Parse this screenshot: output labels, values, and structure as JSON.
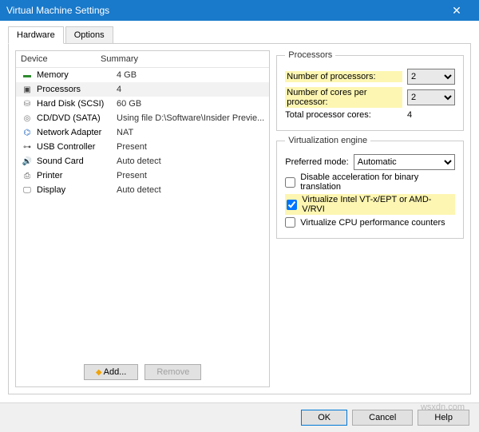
{
  "window": {
    "title": "Virtual Machine Settings"
  },
  "tabs": {
    "hardware": "Hardware",
    "options": "Options"
  },
  "devheader": {
    "device": "Device",
    "summary": "Summary"
  },
  "devices": [
    {
      "name": "Memory",
      "summary": "4 GB",
      "iconColor": "#2e8b2e",
      "glyph": "▬"
    },
    {
      "name": "Processors",
      "summary": "4",
      "iconColor": "#444",
      "glyph": "▣",
      "selected": true
    },
    {
      "name": "Hard Disk (SCSI)",
      "summary": "60 GB",
      "iconColor": "#777",
      "glyph": "⛁"
    },
    {
      "name": "CD/DVD (SATA)",
      "summary": "Using file D:\\Software\\Insider Previe...",
      "iconColor": "#777",
      "glyph": "◎"
    },
    {
      "name": "Network Adapter",
      "summary": "NAT",
      "iconColor": "#2a6cc2",
      "glyph": "⌬"
    },
    {
      "name": "USB Controller",
      "summary": "Present",
      "iconColor": "#555",
      "glyph": "⊶"
    },
    {
      "name": "Sound Card",
      "summary": "Auto detect",
      "iconColor": "#c78b1d",
      "glyph": "🔊"
    },
    {
      "name": "Printer",
      "summary": "Present",
      "iconColor": "#555",
      "glyph": "⎙"
    },
    {
      "name": "Display",
      "summary": "Auto detect",
      "iconColor": "#555",
      "glyph": "🖵"
    }
  ],
  "buttons": {
    "add": "Add...",
    "remove": "Remove",
    "ok": "OK",
    "cancel": "Cancel",
    "help": "Help"
  },
  "proc": {
    "legend": "Processors",
    "numProcLabel": "Number of processors:",
    "numProcValue": "2",
    "coresLabel": "Number of cores per processor:",
    "coresValue": "2",
    "totalLabel": "Total processor cores:",
    "totalValue": "4"
  },
  "virt": {
    "legend": "Virtualization engine",
    "prefLabel": "Preferred mode:",
    "prefValue": "Automatic",
    "cb1": "Disable acceleration for binary translation",
    "cb2": "Virtualize Intel VT-x/EPT or AMD-V/RVI",
    "cb3": "Virtualize CPU performance counters"
  },
  "watermark": "wsxdn.com"
}
